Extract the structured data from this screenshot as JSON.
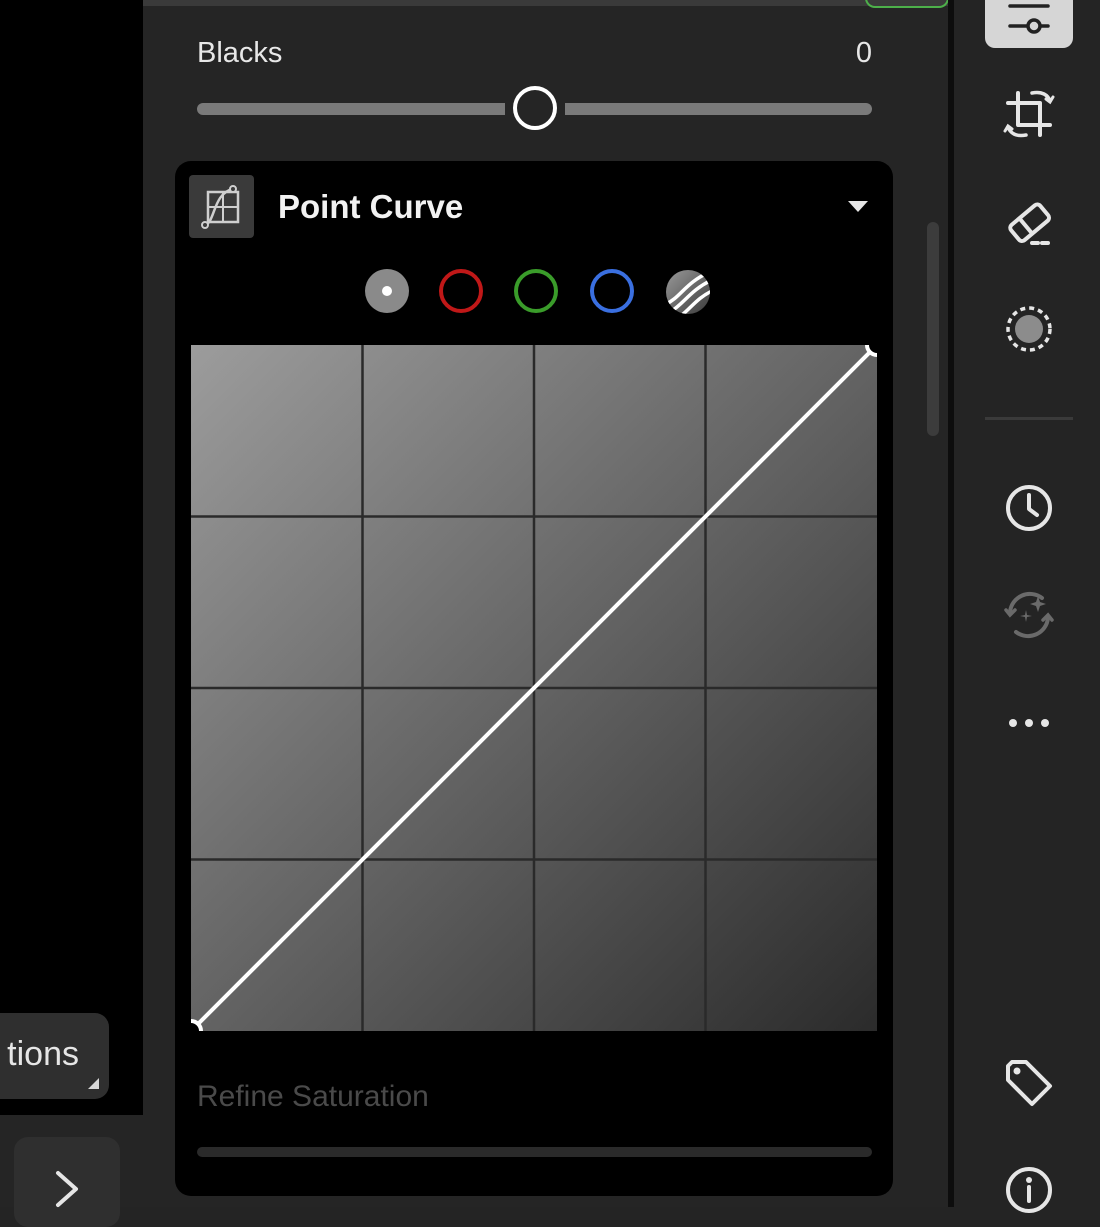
{
  "left": {
    "options_label": "tions"
  },
  "edit_panel": {
    "blacks": {
      "label": "Blacks",
      "value": "0",
      "level": 0.5
    },
    "point_curve": {
      "title": "Point Curve",
      "channels": [
        "parametric-rgb",
        "red",
        "green",
        "blue",
        "refine-saturation"
      ],
      "selected_channel": "parametric-rgb",
      "curve_points": [
        [
          0,
          0
        ],
        [
          255,
          255
        ]
      ],
      "refine_label": "Refine Saturation"
    }
  },
  "toolbar": {
    "tools": [
      "edit-icon",
      "crop-icon",
      "remove-icon",
      "masking-icon",
      "history-icon",
      "presets-icon",
      "more-icon",
      "keywords-icon",
      "info-icon"
    ],
    "active_tool": "edit-icon"
  },
  "colors": {
    "panel_bg": "#252525",
    "card_bg": "#000000",
    "red_channel": "#c01818",
    "green_channel": "#3a9c2a",
    "blue_channel": "#3a6fe0"
  }
}
